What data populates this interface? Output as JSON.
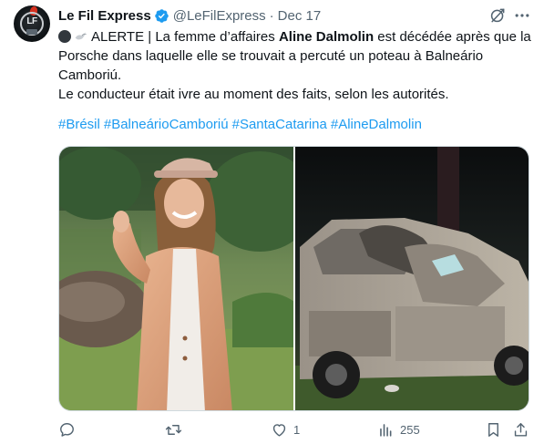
{
  "author": {
    "display_name": "Le Fil Express",
    "handle": "@LeFilExpress",
    "separator": "·",
    "date": "Dec 17",
    "avatar_text": "LF",
    "verified_icon": "verified-badge-icon"
  },
  "tweet": {
    "line1_prefix": "ALERTE | La femme d’affaires ",
    "line1_name": "Aline Dalmolin",
    "line1_suffix": " est décédée après que la",
    "line2": "Porsche dans laquelle elle se trouvait a percuté un poteau à Balneário",
    "line3": "Camboriú.",
    "line4": "Le conducteur était ivre au moment des faits, selon les autorités.",
    "hashtags": [
      "#Brésil",
      "#BalneárioCamboriú",
      "#SantaCatarina",
      "#AlineDalmolin"
    ]
  },
  "media": {
    "images": [
      "woman-portrait-photo",
      "crashed-car-photo"
    ]
  },
  "actions": {
    "reply_count": "",
    "repost_count": "",
    "like_count": "1",
    "views_count": "255"
  },
  "colors": {
    "link": "#1d9bf0",
    "secondary_text": "#536471",
    "primary_text": "#0f1419",
    "verified": "#1d9bf0"
  }
}
